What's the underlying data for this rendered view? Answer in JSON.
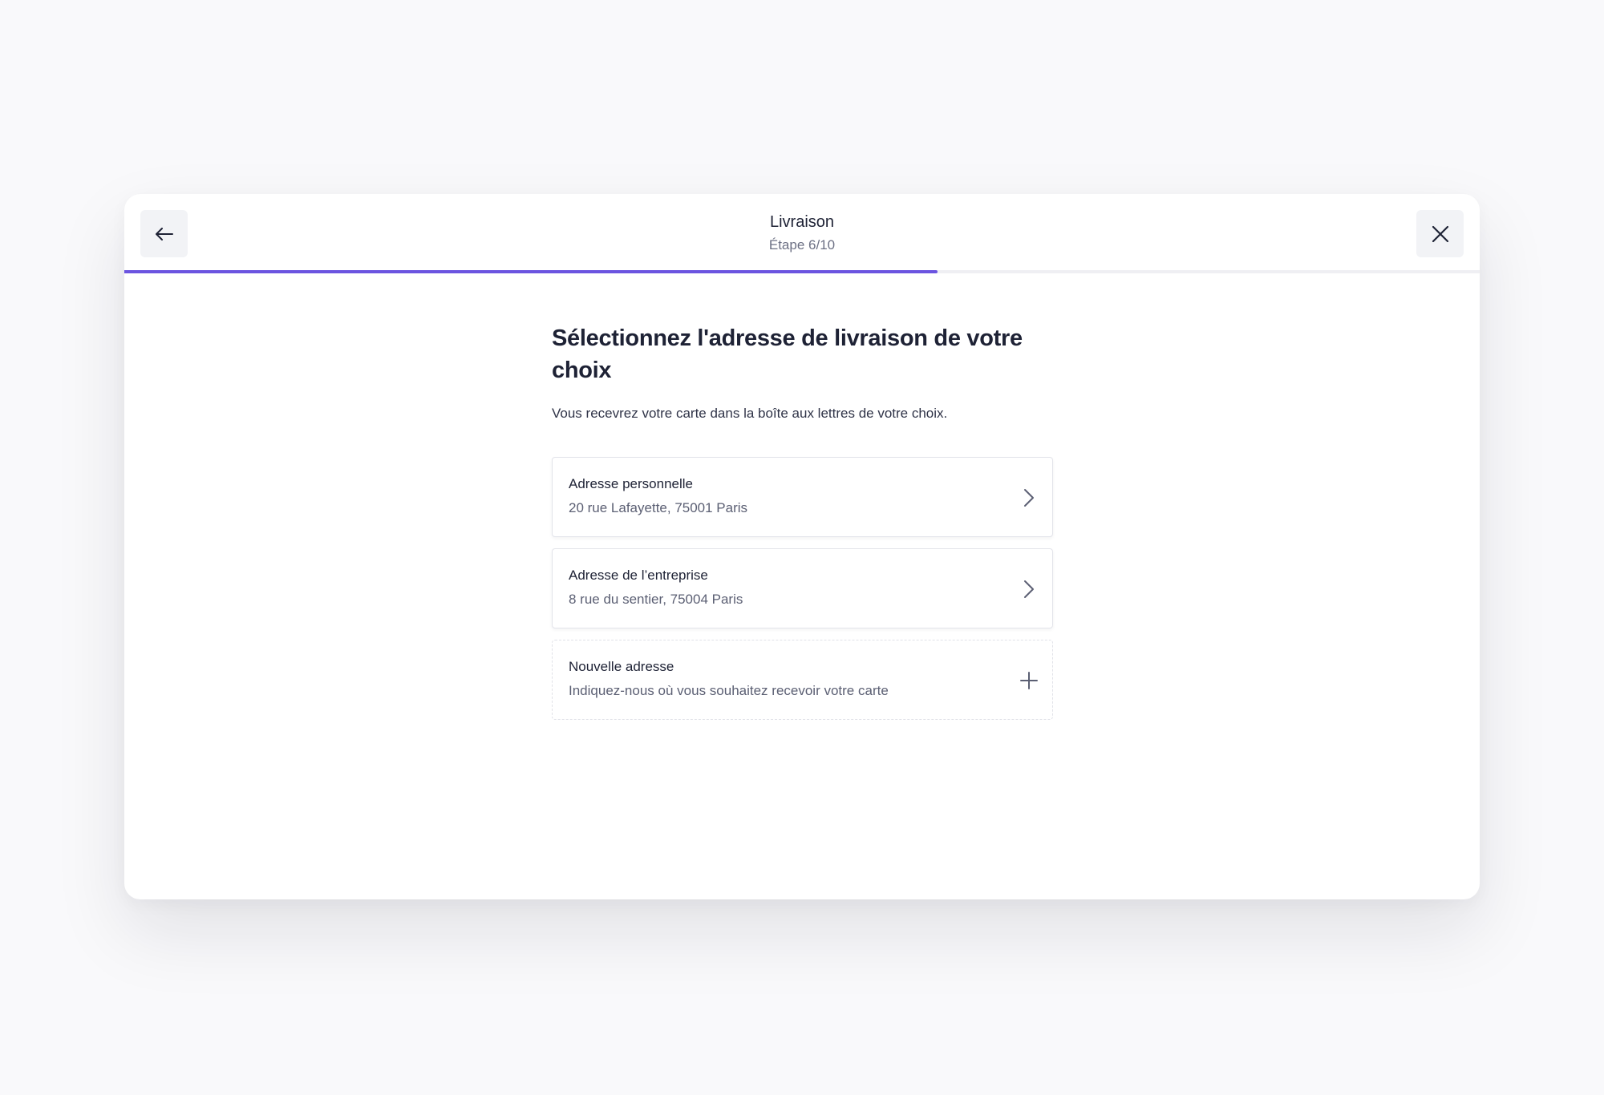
{
  "header": {
    "title": "Livraison",
    "step": "Étape 6/10",
    "progress": 0.6
  },
  "main": {
    "title": "Sélectionnez l'adresse de livraison de votre choix",
    "subtitle": "Vous recevrez votre carte dans la boîte aux lettres de votre choix."
  },
  "options": [
    {
      "title": "Adresse personnelle",
      "description": "20 rue Lafayette, 75001 Paris",
      "icon": "chevron-right-icon"
    },
    {
      "title": "Adresse de l’entreprise",
      "description": "8 rue du sentier, 75004 Paris",
      "icon": "chevron-right-icon"
    },
    {
      "title": "Nouvelle adresse",
      "description": "Indiquez-nous où vous souhaitez recevoir votre carte",
      "icon": "plus-icon"
    }
  ],
  "colors": {
    "accent": "#6b54e0",
    "background": "#f9f9fb"
  }
}
